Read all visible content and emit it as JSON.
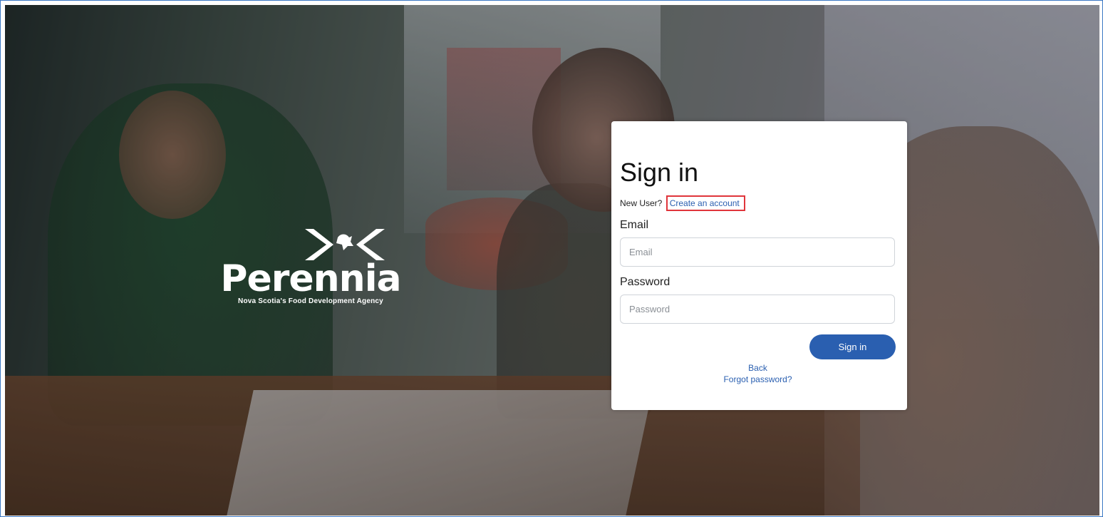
{
  "brand": {
    "name": "Perennia",
    "tagline": "Nova Scotia's Food Development Agency",
    "logo_icon": "perennia-logo-icon"
  },
  "signin": {
    "title": "Sign in",
    "new_user_text": "New User?",
    "create_account_link": "Create an account",
    "email_label": "Email",
    "email_placeholder": "Email",
    "email_value": "",
    "password_label": "Password",
    "password_placeholder": "Password",
    "password_value": "",
    "submit_label": "Sign in",
    "back_link": "Back",
    "forgot_link": "Forgot password?"
  },
  "colors": {
    "accent": "#2a5fb0",
    "highlight_border": "#e0353b",
    "panel_bg": "#ffffff"
  }
}
